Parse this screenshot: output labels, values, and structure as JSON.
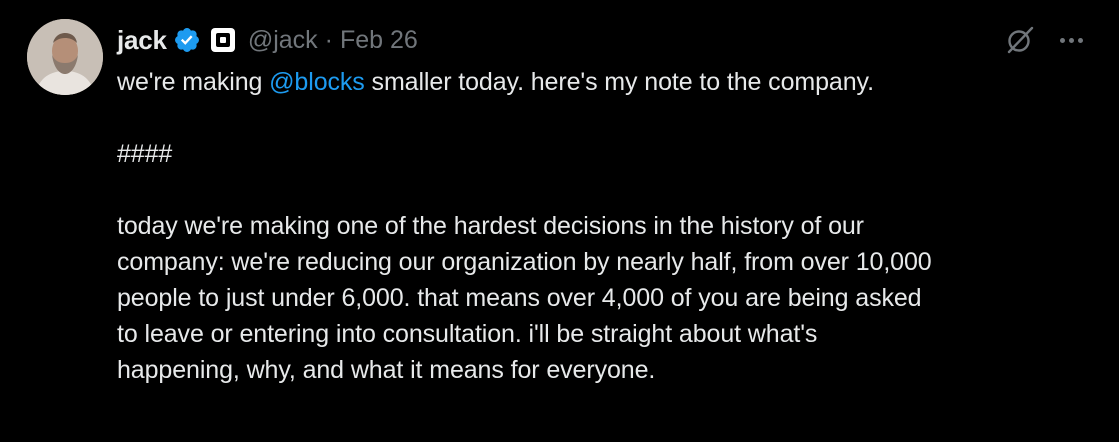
{
  "tweet": {
    "author_name": "jack",
    "handle": "@jack",
    "separator": "·",
    "date": "Feb 26",
    "line1_before": "we're making ",
    "mention": "@blocks",
    "line1_after": " smaller today. here's my note to the company.",
    "divider": "####",
    "paragraph_lines": [
      "today we're making one of the hardest decisions in the history of our",
      "company: we're reducing our organization by nearly half, from over 10,000",
      "people to just under 6,000. that means over 4,000 of you are being asked",
      "to leave or entering into consultation. i'll be straight about what's",
      "happening, why, and what it means for everyone."
    ]
  },
  "icons": {
    "verified": "verified-badge-icon",
    "affiliation": "block-affiliation-icon",
    "grok": "grok-icon",
    "more": "more-options-icon"
  },
  "colors": {
    "background": "#000000",
    "text": "#e7e9ea",
    "secondary": "#71767b",
    "link": "#1d9bf0"
  }
}
